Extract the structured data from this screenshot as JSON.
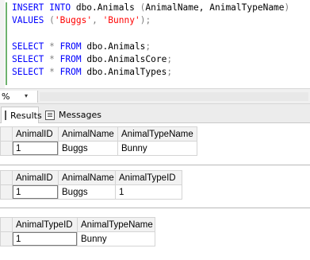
{
  "editor": {
    "line1": {
      "kw": "INSERT INTO",
      "table": " dbo.Animals ",
      "open": "(",
      "cols": "AnimalName, AnimalTypeName",
      "close": ")"
    },
    "line2": {
      "kw": "VALUES",
      "sp": " ",
      "open": "(",
      "v1": "'Buggs'",
      "comma": ", ",
      "v2": "'Bunny'",
      "close": ");"
    },
    "line4": {
      "kw1": "SELECT",
      "star": " * ",
      "kw2": "FROM",
      "rest": " dbo.Animals",
      "semi": ";"
    },
    "line5": {
      "kw1": "SELECT",
      "star": " * ",
      "kw2": "FROM",
      "rest": " dbo.AnimalsCore",
      "semi": ";"
    },
    "line6": {
      "kw1": "SELECT",
      "star": " * ",
      "kw2": "FROM",
      "rest": " dbo.AnimalTypes",
      "semi": ";"
    }
  },
  "zoom": {
    "value": "%",
    "arrow": "▾"
  },
  "tabs": {
    "results": "Results",
    "messages": "Messages"
  },
  "results": [
    {
      "columns": [
        "AnimalID",
        "AnimalName",
        "AnimalTypeName"
      ],
      "rows": [
        [
          "1",
          "Buggs",
          "Bunny"
        ]
      ],
      "row_numbers": [
        "1"
      ]
    },
    {
      "columns": [
        "AnimalID",
        "AnimalName",
        "AnimalTypeID"
      ],
      "rows": [
        [
          "1",
          "Buggs",
          "1"
        ]
      ],
      "row_numbers": [
        "1"
      ]
    },
    {
      "columns": [
        "AnimalTypeID",
        "AnimalTypeName"
      ],
      "rows": [
        [
          "1",
          "Bunny"
        ]
      ],
      "row_numbers": [
        "1"
      ]
    }
  ],
  "colors": {
    "keyword": "#0000ff",
    "string": "#ff0000",
    "operator": "#808080",
    "change_bar": "#6eb26e"
  }
}
